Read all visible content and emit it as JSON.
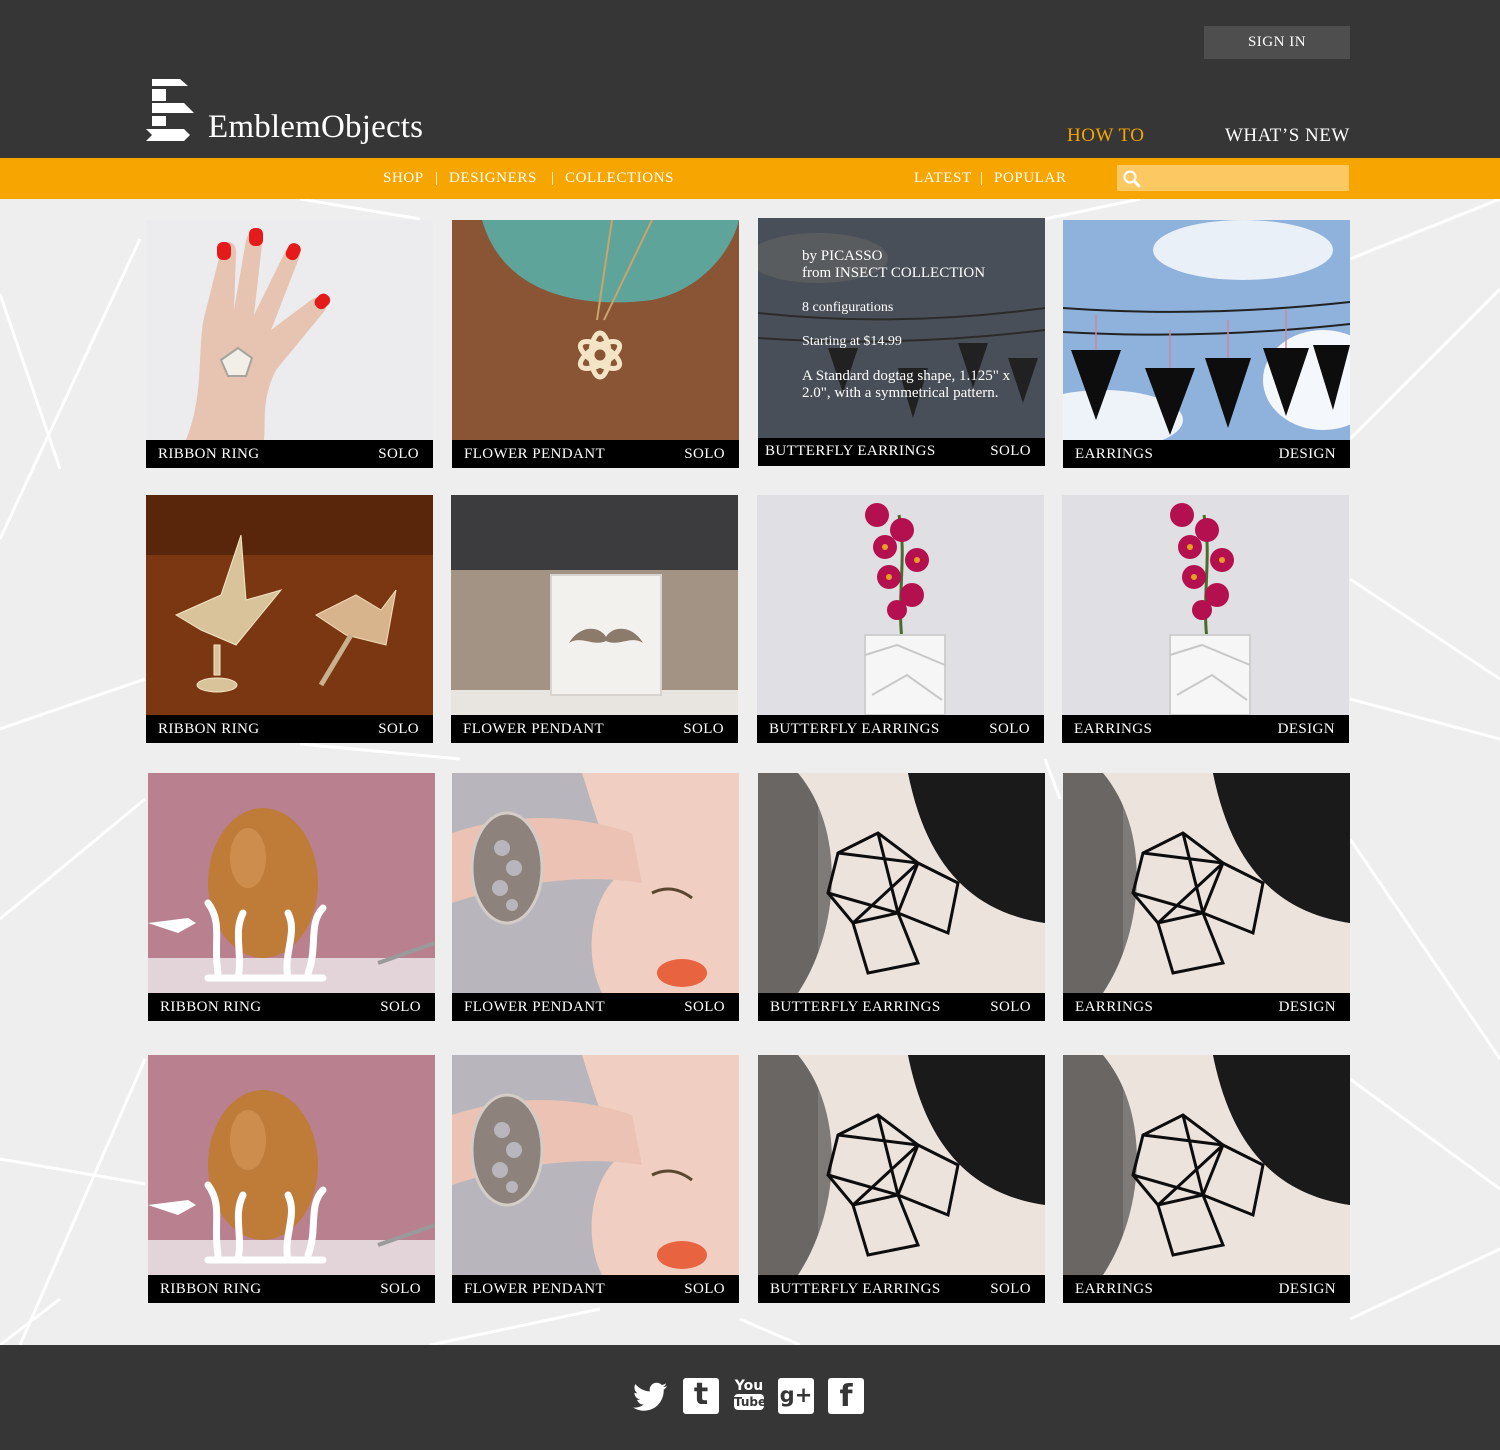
{
  "header": {
    "sign_in": "SIGN IN",
    "logo_text": "EmblemObjects",
    "how_to": "HOW TO",
    "whats_new": "WHAT’S NEW"
  },
  "nav": {
    "shop": "SHOP",
    "designers": "DESIGNERS",
    "collections": "COLLECTIONS",
    "latest": "LATEST",
    "popular": "POPULAR",
    "separator": "|",
    "search_placeholder": ""
  },
  "colors": {
    "header_bg": "#363636",
    "accent": "#f7a500",
    "search_bg": "#fcc862",
    "page_bg": "#eeeeee"
  },
  "overlay": {
    "designer": "by PICASSO",
    "collection": "from INSECT COLLECTION",
    "configurations": "8 configurations",
    "price": "Starting at $14.99",
    "description": "A Standard dogtag shape, 1.125\" x 2.0\", with a symmetrical pattern."
  },
  "products": [
    {
      "name": "RIBBON RING",
      "type": "SOLO",
      "image": "hand-ring-photo"
    },
    {
      "name": "FLOWER PENDANT",
      "type": "SOLO",
      "image": "flower-pendant-photo"
    },
    {
      "name": "BUTTERFLY EARRINGS",
      "type": "SOLO",
      "image": "butterfly-earrings-photo"
    },
    {
      "name": "EARRINGS",
      "type": "DESIGN",
      "image": "butterfly-earrings-photo"
    },
    {
      "name": "RIBBON RING",
      "type": "SOLO",
      "image": "origami-crane-photo"
    },
    {
      "name": "FLOWER PENDANT",
      "type": "SOLO",
      "image": "mustache-buckle-photo"
    },
    {
      "name": "BUTTERFLY EARRINGS",
      "type": "SOLO",
      "image": "orchid-vase-photo"
    },
    {
      "name": "EARRINGS",
      "type": "DESIGN",
      "image": "orchid-vase-photo"
    },
    {
      "name": "RIBBON RING",
      "type": "SOLO",
      "image": "egg-cup-photo"
    },
    {
      "name": "FLOWER PENDANT",
      "type": "SOLO",
      "image": "bracelet-photo"
    },
    {
      "name": "BUTTERFLY EARRINGS",
      "type": "SOLO",
      "image": "geometric-necklace-photo"
    },
    {
      "name": "EARRINGS",
      "type": "DESIGN",
      "image": "geometric-necklace-photo"
    },
    {
      "name": "RIBBON RING",
      "type": "SOLO",
      "image": "egg-cup-photo"
    },
    {
      "name": "FLOWER PENDANT",
      "type": "SOLO",
      "image": "bracelet-photo"
    },
    {
      "name": "BUTTERFLY EARRINGS",
      "type": "SOLO",
      "image": "geometric-necklace-photo"
    },
    {
      "name": "EARRINGS",
      "type": "DESIGN",
      "image": "geometric-necklace-photo"
    }
  ],
  "social": [
    "twitter-icon",
    "tumblr-icon",
    "youtube-icon",
    "google-plus-icon",
    "facebook-icon"
  ],
  "icons": {
    "youtube_top": "You",
    "youtube_bottom": "Tube",
    "google_plus": "g+",
    "tumblr": "t",
    "facebook": "f"
  }
}
